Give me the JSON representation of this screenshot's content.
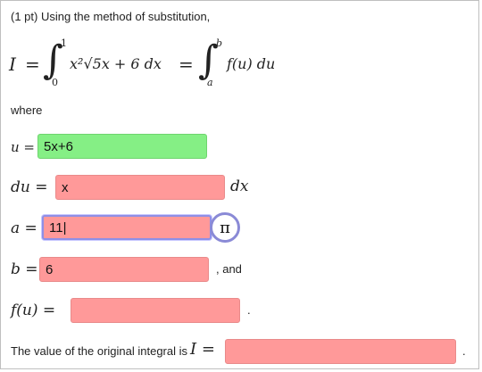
{
  "problem": {
    "header": "(1 pt) Using the method of substitution,",
    "where_label": "where"
  },
  "equation": {
    "lhs_var": "I",
    "equals": "=",
    "lower1": "0",
    "upper1": "1",
    "integrand": "x²√5x + 6 dx",
    "lower2": "a",
    "upper2": "b",
    "integrand2": "f(u) du"
  },
  "rows": {
    "u": {
      "label": "u =",
      "value": "5x+6"
    },
    "du": {
      "label": "du =",
      "value": "x",
      "suffix": "dx"
    },
    "a": {
      "label": "a =",
      "value": "11|"
    },
    "b": {
      "label": "b =",
      "value": "6",
      "suffix": ", and"
    },
    "fu": {
      "label": "f(u) =",
      "value": "",
      "suffix": "."
    },
    "final": {
      "label": "The value of the original integral is",
      "var": "I =",
      "value": "",
      "suffix": "."
    }
  },
  "pi_button": {
    "symbol": "π"
  },
  "colors": {
    "correct": "#85ef85",
    "incorrect": "#ff9999",
    "focus": "#8f8fe6"
  }
}
